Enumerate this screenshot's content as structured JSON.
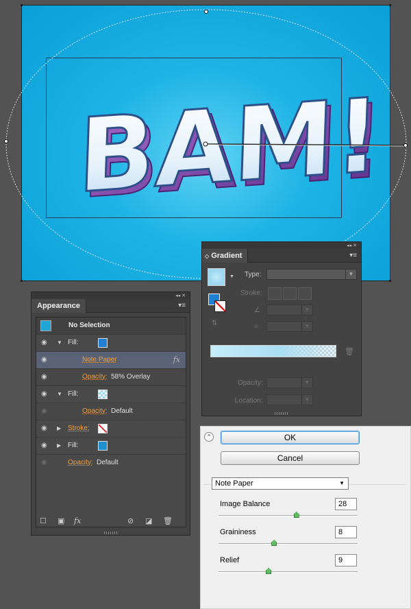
{
  "artboard": {
    "text": "BAM!"
  },
  "appearance": {
    "tab": "Appearance",
    "header": "No Selection",
    "rows": [
      {
        "type": "fill",
        "label": "Fill:",
        "swatch": "#1f7fd0"
      },
      {
        "type": "effect",
        "label": "Note Paper",
        "fx": "fx"
      },
      {
        "type": "opacity",
        "label": "Opacity:",
        "value": "58% Overlay"
      },
      {
        "type": "fill",
        "label": "Fill:",
        "swatch": "checker"
      },
      {
        "type": "opacity",
        "label": "Opacity:",
        "value": "Default"
      },
      {
        "type": "stroke",
        "label": "Stroke:",
        "swatch": "none"
      },
      {
        "type": "fill",
        "label": "Fill:",
        "swatch": "#1f8fd0"
      },
      {
        "type": "opacity",
        "label": "Opacity:",
        "value": "Default"
      }
    ],
    "footer_fx": "fx"
  },
  "gradient": {
    "tab": "Gradient",
    "type_label": "Type:",
    "stroke_label": "Stroke:",
    "opacity_label": "Opacity:",
    "location_label": "Location:"
  },
  "notepaper": {
    "ok": "OK",
    "cancel": "Cancel",
    "filter": "Note Paper",
    "params": [
      {
        "label": "Image Balance",
        "value": "28",
        "pct": 0.56
      },
      {
        "label": "Graininess",
        "value": "8",
        "pct": 0.4
      },
      {
        "label": "Relief",
        "value": "9",
        "pct": 0.36
      }
    ]
  },
  "colors": {
    "canvas": "#535353",
    "artboard": "#1fb4e6",
    "accent_orange": "#f0a040"
  }
}
